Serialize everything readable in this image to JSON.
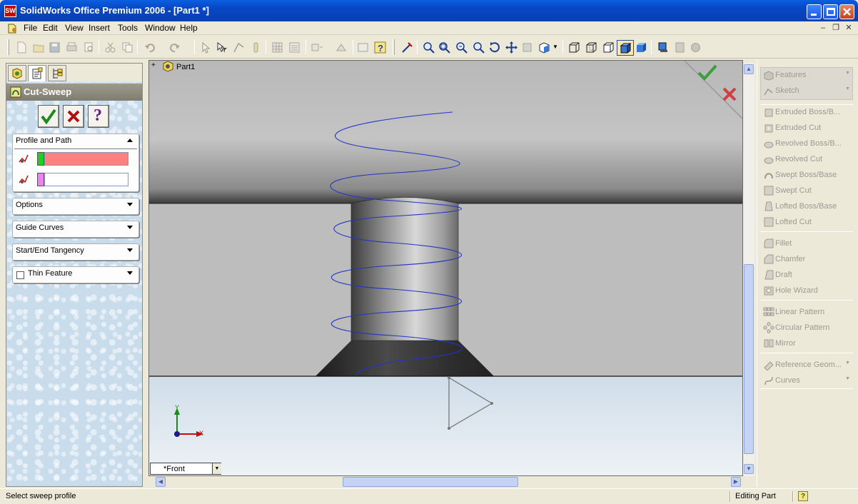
{
  "window": {
    "title": "SolidWorks Office Premium 2006 - [Part1 *]",
    "app_icon_text": "SW"
  },
  "menubar": {
    "items": [
      "File",
      "Edit",
      "View",
      "Insert",
      "Tools",
      "Window",
      "Help"
    ]
  },
  "feature_manager": {
    "tabs": [
      "feature-manager-tab",
      "property-manager-tab",
      "configuration-manager-tab"
    ],
    "active_tab": 1
  },
  "property_manager": {
    "title": "Cut-Sweep",
    "ok_icon": "check-icon",
    "cancel_icon": "cross-icon",
    "help_label": "?",
    "groups": {
      "profile_and_path": {
        "label": "Profile and Path",
        "expanded": true,
        "profile_value": "",
        "path_value": "",
        "profile_color": "#ff8080",
        "profile_swatch": "#22cc22",
        "path_swatch": "#ee82ee"
      },
      "options": {
        "label": "Options"
      },
      "guide_curves": {
        "label": "Guide Curves"
      },
      "tangency": {
        "label": "Start/End Tangency"
      },
      "thin_feature": {
        "label": "Thin Feature",
        "checked": false
      }
    }
  },
  "graphics_area": {
    "tree_root": "Part1",
    "tree_expander": "+",
    "view_name": "*Front",
    "triad": {
      "x": "X",
      "y": "Y"
    },
    "confirm_ok": "check-icon",
    "confirm_cancel": "cross-icon",
    "background_top": "#b7b7b7",
    "background_bottom": "#e6eef6"
  },
  "task_pane": {
    "headers": [
      {
        "label": "Features"
      },
      {
        "label": "Sketch"
      }
    ],
    "group1": [
      "Extruded Boss/B...",
      "Extruded Cut",
      "Revolved Boss/B...",
      "Revolved Cut",
      "Swept Boss/Base",
      "Swept Cut",
      "Lofted Boss/Base",
      "Lofted Cut"
    ],
    "group2": [
      "Fillet",
      "Chamfer",
      "Draft",
      "Hole Wizard"
    ],
    "group3": [
      "Linear Pattern",
      "Circular Pattern",
      "Mirror"
    ],
    "group4": [
      {
        "label": "Reference Geom..."
      },
      {
        "label": "Curves"
      }
    ]
  },
  "status_bar": {
    "message": "Select sweep profile",
    "mode": "Editing Part",
    "help_icon": "?"
  }
}
